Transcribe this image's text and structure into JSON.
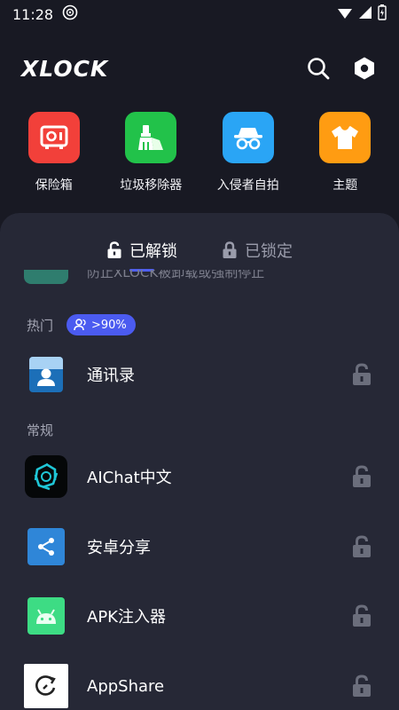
{
  "status_bar": {
    "time": "11:28"
  },
  "header": {
    "logo": "XLOCK"
  },
  "features": [
    {
      "label": "保险箱",
      "color": "#f2403a",
      "icon": "safe-icon"
    },
    {
      "label": "垃圾移除器",
      "color": "#22c24a",
      "icon": "broom-icon"
    },
    {
      "label": "入侵者自拍",
      "color": "#2aa5f5",
      "icon": "spy-icon"
    },
    {
      "label": "主题",
      "color": "#ff9c12",
      "icon": "shirt-icon"
    }
  ],
  "tabs": [
    {
      "label": "已解锁",
      "active": true
    },
    {
      "label": "已锁定",
      "active": false
    }
  ],
  "partial_row_text": "防止XLOCK被卸载或强制停止",
  "sections": {
    "popular": {
      "title": "热门",
      "badge": ">90%"
    },
    "general": {
      "title": "常规"
    }
  },
  "apps": [
    {
      "name": "通讯录",
      "icon": "contacts-icon"
    },
    {
      "name": "AIChat中文",
      "icon": "aichat-icon"
    },
    {
      "name": "安卓分享",
      "icon": "share-icon"
    },
    {
      "name": "APK注入器",
      "icon": "android-icon"
    },
    {
      "name": "AppShare",
      "icon": "appshare-icon"
    }
  ],
  "colors": {
    "background": "#181923",
    "sheet": "#262836",
    "accent": "#4b5bf0"
  }
}
